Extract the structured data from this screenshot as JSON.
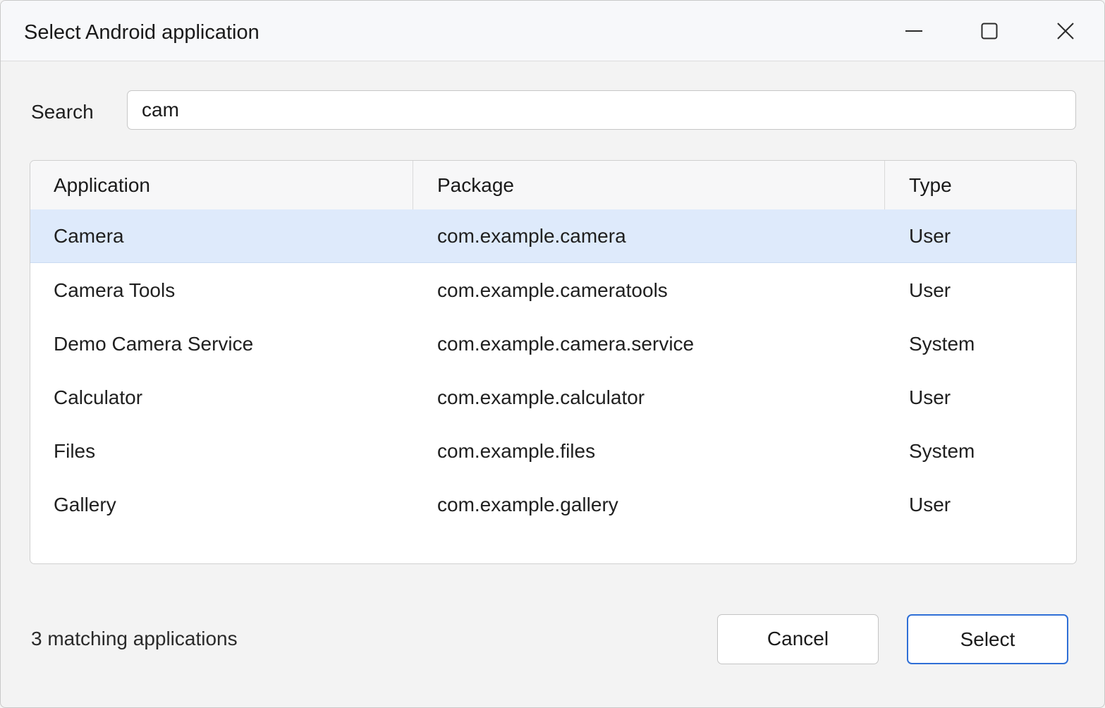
{
  "window": {
    "title": "Select Android application",
    "controls": {
      "minimize_icon": "minimize-icon",
      "maximize_icon": "maximize-icon",
      "close_icon": "close-icon"
    }
  },
  "search": {
    "label": "Search",
    "value": "cam"
  },
  "table": {
    "columns": [
      "Application",
      "Package",
      "Type"
    ],
    "rows": [
      {
        "application": "Camera",
        "package": "com.example.camera",
        "type": "User",
        "selected": true
      },
      {
        "application": "Camera Tools",
        "package": "com.example.cameratools",
        "type": "User",
        "selected": false
      },
      {
        "application": "Demo Camera Service",
        "package": "com.example.camera.service",
        "type": "System",
        "selected": false
      },
      {
        "application": "Calculator",
        "package": "com.example.calculator",
        "type": "User",
        "selected": false
      },
      {
        "application": "Files",
        "package": "com.example.files",
        "type": "System",
        "selected": false
      },
      {
        "application": "Gallery",
        "package": "com.example.gallery",
        "type": "User",
        "selected": false
      }
    ]
  },
  "footer": {
    "status": "3 matching applications",
    "cancel_label": "Cancel",
    "select_label": "Select"
  },
  "colors": {
    "selected_row": "#deeafb",
    "primary_border": "#2f6fd6"
  }
}
